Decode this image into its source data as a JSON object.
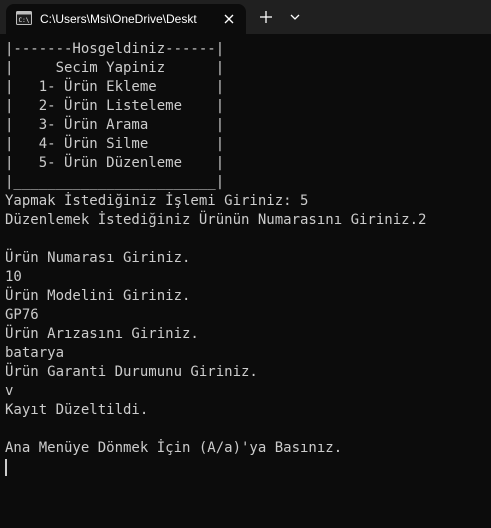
{
  "tab": {
    "title": "C:\\Users\\Msi\\OneDrive\\Deskt",
    "icon": "terminal-icon"
  },
  "icons": {
    "close": "close-icon",
    "new_tab": "plus-icon",
    "dropdown": "chevron-down-icon"
  },
  "colors": {
    "background": "#0c0c0c",
    "text": "#cccccc",
    "tabbar": "#202020"
  },
  "terminal": {
    "lines": [
      "|-------Hosgeldiniz------|",
      "|     Secim Yapiniz      |",
      "|   1- Ürün Ekleme       |",
      "|   2- Ürün Listeleme    |",
      "|   3- Ürün Arama        |",
      "|   4- Ürün Silme        |",
      "|   5- Ürün Düzenleme    |",
      "|________________________|",
      "Yapmak İstediğiniz İşlemi Giriniz: 5",
      "Düzenlemek İstediğiniz Ürünün Numarasını Giriniz.2",
      "",
      "Ürün Numarası Giriniz.",
      "10",
      "Ürün Modelini Giriniz.",
      "GP76",
      "Ürün Arızasını Giriniz.",
      "batarya",
      "Ürün Garanti Durumunu Giriniz.",
      "v",
      "Kayıt Düzeltildi.",
      "",
      "Ana Menüye Dönmek İçin (A/a)'ya Basınız."
    ]
  }
}
